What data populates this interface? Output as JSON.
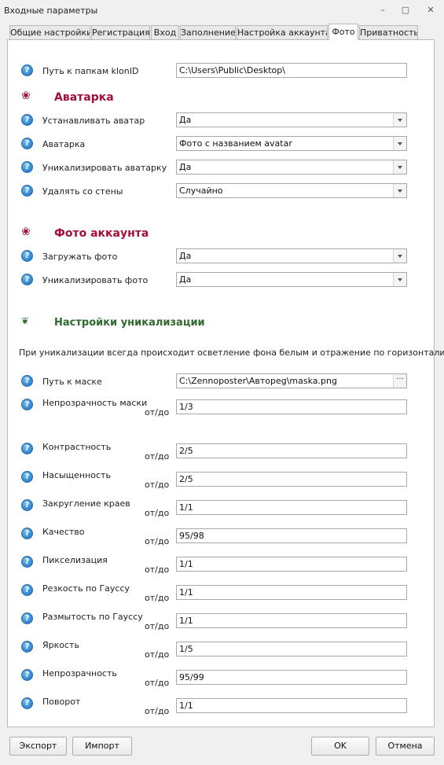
{
  "window": {
    "title": "Входные параметры",
    "controls": {
      "minimize": "–",
      "maximize": "▢",
      "close": "✕"
    }
  },
  "tabs": [
    {
      "label": "Общие настройки"
    },
    {
      "label": "Регистрация"
    },
    {
      "label": "Вход"
    },
    {
      "label": "Заполнение"
    },
    {
      "label": "Настройка аккаунта"
    },
    {
      "label": "Фото",
      "active": true
    },
    {
      "label": "Приватность"
    }
  ],
  "help_glyph": "?",
  "browse_glyph": "···",
  "otdo": "от/до",
  "folder_path": {
    "label": "Путь к папкам klonID",
    "value": "C:\\Users\\Public\\Desktop\\"
  },
  "avatar_section": {
    "title": "Аватарка",
    "icon": "flower-icon",
    "rows": [
      {
        "label": "Устанавливать аватар",
        "value": "Да"
      },
      {
        "label": "Аватарка",
        "value": "Фото с названием avatar"
      },
      {
        "label": "Уникализировать аватарку",
        "value": "Да"
      },
      {
        "label": "Удалять со стены",
        "value": "Случайно"
      }
    ]
  },
  "photo_section": {
    "title": "Фото аккаунта",
    "icon": "flower-icon",
    "rows": [
      {
        "label": "Загружать фото",
        "value": "Да"
      },
      {
        "label": "Уникализировать фото",
        "value": "Да"
      }
    ]
  },
  "uniq_section": {
    "title": "Настройки уникализации",
    "icon": "leaf-icon",
    "note": "При уникализации всегда происходит осветление фона белым и отражение по горизонтали.",
    "mask_path": {
      "label": "Путь к маске",
      "value": "C:\\Zennoposter\\Автореg\\maska.png"
    },
    "opacity_mask": {
      "label": "Непрозрачность маски",
      "value": "1/3"
    },
    "ranges": [
      {
        "label": "Контрастность",
        "value": "2/5"
      },
      {
        "label": "Насыщенность",
        "value": "2/5"
      },
      {
        "label": "Закругление краев",
        "value": "1/1"
      },
      {
        "label": "Качество",
        "value": "95/98"
      },
      {
        "label": "Пикселизация",
        "value": "1/1"
      },
      {
        "label": "Резкость по Гауссу",
        "value": "1/1"
      },
      {
        "label": "Размытость  по Гауссу",
        "value": "1/1"
      },
      {
        "label": "Яркость",
        "value": "1/5"
      },
      {
        "label": "Непрозрачность",
        "value": "95/99"
      },
      {
        "label": "Поворот",
        "value": "1/1"
      }
    ]
  },
  "buttons": {
    "export": "Экспорт",
    "import": "Импорт",
    "ok": "OK",
    "cancel": "Отмена"
  },
  "colors": {
    "section_red": "#a0103a",
    "section_green": "#2f6b2f",
    "help_blue": "#3a8fd4"
  }
}
